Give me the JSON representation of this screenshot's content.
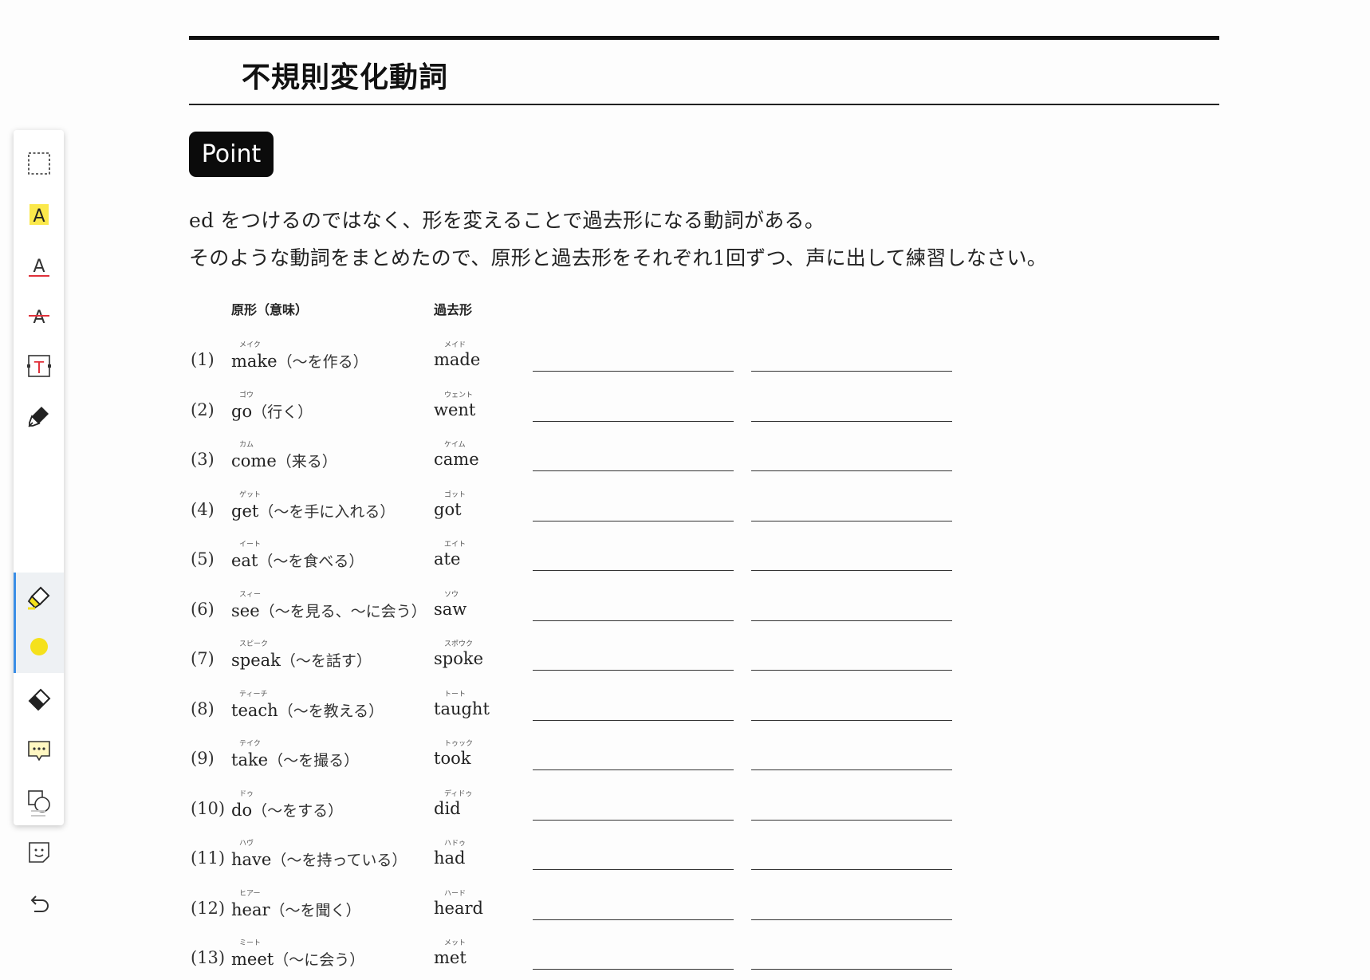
{
  "toolbar": {
    "tools": [
      {
        "name": "selection-tool",
        "icon": "dashed-rectangle-icon"
      },
      {
        "name": "highlight-text-tool",
        "icon": "highlighted-a-icon",
        "letter": "A"
      },
      {
        "name": "underline-text-tool",
        "icon": "underlined-a-icon",
        "letter": "A"
      },
      {
        "name": "strikethrough-text-tool",
        "icon": "strikethrough-a-icon",
        "letter": "A"
      },
      {
        "name": "text-box-tool",
        "icon": "text-box-icon",
        "letter": "T"
      },
      {
        "name": "pen-tool",
        "icon": "pen-icon"
      },
      {
        "name": "highlighter-tool",
        "icon": "highlighter-icon",
        "active": true
      },
      {
        "name": "color-picker",
        "icon": "yellow-dot-icon",
        "color": "#f5e11c"
      },
      {
        "name": "eraser-tool",
        "icon": "eraser-icon"
      },
      {
        "name": "comment-tool",
        "icon": "comment-icon"
      },
      {
        "name": "shape-tool",
        "icon": "shapes-icon"
      },
      {
        "name": "sticker-tool",
        "icon": "sticker-icon"
      },
      {
        "name": "undo-button",
        "icon": "undo-icon"
      }
    ],
    "accent_color": "#3a8ee6"
  },
  "page": {
    "title": "不規則変化動詞",
    "badge": "Point",
    "intro_line1": "ed をつけるのではなく、形を変えることで過去形になる動詞がある。",
    "intro_line2": "そのような動詞をまとめたので、原形と過去形をそれぞれ1回ずつ、声に出して練習しなさい。",
    "col_base": "原形（意味）",
    "col_past": "過去形"
  },
  "verbs": [
    {
      "num": "(1)",
      "base": "make",
      "ruby_base": "メイク",
      "meaning": "（～を作る）",
      "past": "made",
      "ruby_past": "メイド"
    },
    {
      "num": "(2)",
      "base": "go",
      "ruby_base": "ゴウ",
      "meaning": "（行く）",
      "past": "went",
      "ruby_past": "ウェント"
    },
    {
      "num": "(3)",
      "base": "come",
      "ruby_base": "カム",
      "meaning": "（来る）",
      "past": "came",
      "ruby_past": "ケイム"
    },
    {
      "num": "(4)",
      "base": "get",
      "ruby_base": "ゲット",
      "meaning": "（～を手に入れる）",
      "past": "got",
      "ruby_past": "ゴット"
    },
    {
      "num": "(5)",
      "base": "eat",
      "ruby_base": "イート",
      "meaning": "（～を食べる）",
      "past": "ate",
      "ruby_past": "エイト"
    },
    {
      "num": "(6)",
      "base": "see",
      "ruby_base": "スィー",
      "meaning": "（～を見る、～に会う）",
      "past": "saw",
      "ruby_past": "ソウ"
    },
    {
      "num": "(7)",
      "base": "speak",
      "ruby_base": "スピーク",
      "meaning": "（～を話す）",
      "past": "spoke",
      "ruby_past": "スポウク"
    },
    {
      "num": "(8)",
      "base": "teach",
      "ruby_base": "ティーチ",
      "meaning": "（～を教える）",
      "past": "taught",
      "ruby_past": "トート"
    },
    {
      "num": "(9)",
      "base": "take",
      "ruby_base": "テイク",
      "meaning": "（～を撮る）",
      "past": "took",
      "ruby_past": "トゥック"
    },
    {
      "num": "(10)",
      "base": "do",
      "ruby_base": "ドゥ",
      "meaning": "（～をする）",
      "past": "did",
      "ruby_past": "ディドゥ"
    },
    {
      "num": "(11)",
      "base": "have",
      "ruby_base": "ハヴ",
      "meaning": "（～を持っている）",
      "past": "had",
      "ruby_past": "ハドゥ"
    },
    {
      "num": "(12)",
      "base": "hear",
      "ruby_base": "ヒアー",
      "meaning": "（～を聞く）",
      "past": "heard",
      "ruby_past": "ハード"
    },
    {
      "num": "(13)",
      "base": "meet",
      "ruby_base": "ミート",
      "meaning": "（～に会う）",
      "past": "met",
      "ruby_past": "メット"
    }
  ]
}
